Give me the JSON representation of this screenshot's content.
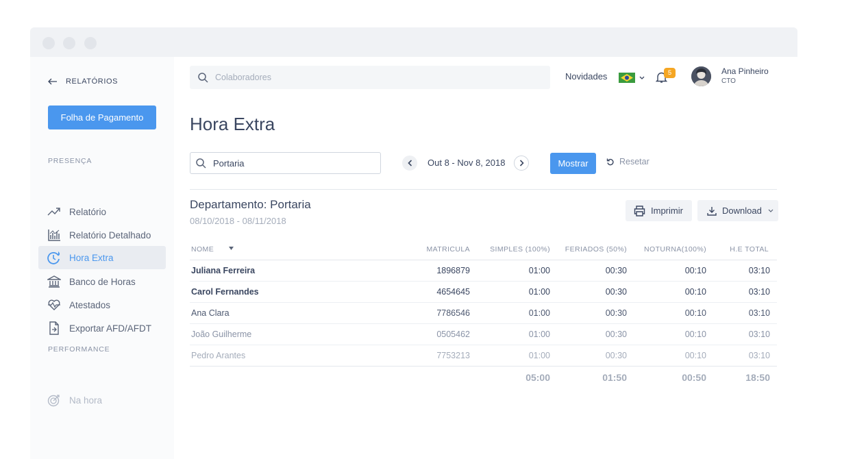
{
  "sidebar": {
    "back_label": "RELATÓRIOS",
    "payroll_button": "Folha de Pagamento",
    "section_presenca": "PRESENÇA",
    "items": [
      {
        "label": "Relatório",
        "icon": "trend-icon"
      },
      {
        "label": "Relatório Detalhado",
        "icon": "bar-chart-icon"
      },
      {
        "label": "Hora Extra",
        "icon": "overtime-clock-icon",
        "active": true
      },
      {
        "label": "Banco de Horas",
        "icon": "bank-icon"
      },
      {
        "label": "Atestados",
        "icon": "heartbeat-icon"
      },
      {
        "label": "Exportar AFD/AFDT",
        "icon": "export-file-icon"
      }
    ],
    "section_performance": "PERFORMANCE",
    "performance_items": [
      {
        "label": "Na hora",
        "icon": "target-icon"
      }
    ]
  },
  "header": {
    "search_placeholder": "Colaboradores",
    "novidades": "Novidades",
    "notifications_count": "5",
    "user_name": "Ana Pinheiro",
    "user_role": "CTO"
  },
  "main": {
    "title": "Hora Extra",
    "filter_value": "Portaria",
    "date_range": "Out 8 - Nov 8, 2018",
    "mostrar": "Mostrar",
    "resetar": "Resetar",
    "department": "Departamento: Portaria",
    "department_dates": "08/10/2018 - 08/11/2018",
    "imprimir": "Imprimir",
    "download": "Download"
  },
  "table": {
    "headers": {
      "nome": "NOME",
      "matricula": "MATRICULA",
      "simples": "SIMPLES (100%)",
      "feriados": "FERIADOS (50%)",
      "noturna": "NOTURNA(100%)",
      "total": "H.E TOTAL"
    },
    "rows": [
      {
        "nome": "Juliana Ferreira",
        "matricula": "1896879",
        "simples": "01:00",
        "feriados": "00:30",
        "noturna": "00:10",
        "total": "03:10"
      },
      {
        "nome": "Carol Fernandes",
        "matricula": "4654645",
        "simples": "01:00",
        "feriados": "00:30",
        "noturna": "00:10",
        "total": "03:10"
      },
      {
        "nome": "Ana Clara",
        "matricula": "7786546",
        "simples": "01:00",
        "feriados": "00:30",
        "noturna": "00:10",
        "total": "03:10"
      },
      {
        "nome": "João Guilherme",
        "matricula": "0505462",
        "simples": "01:00",
        "feriados": "00:30",
        "noturna": "00:10",
        "total": "03:10"
      },
      {
        "nome": "Pedro Arantes",
        "matricula": "7753213",
        "simples": "01:00",
        "feriados": "00:30",
        "noturna": "00:10",
        "total": "03:10"
      }
    ],
    "totals": {
      "simples": "05:00",
      "feriados": "01:50",
      "noturna": "00:50",
      "total": "18:50"
    }
  },
  "colors": {
    "accent": "#4a97ee",
    "text": "#3a4660",
    "muted": "#a4acba",
    "badge": "#f5a623"
  }
}
